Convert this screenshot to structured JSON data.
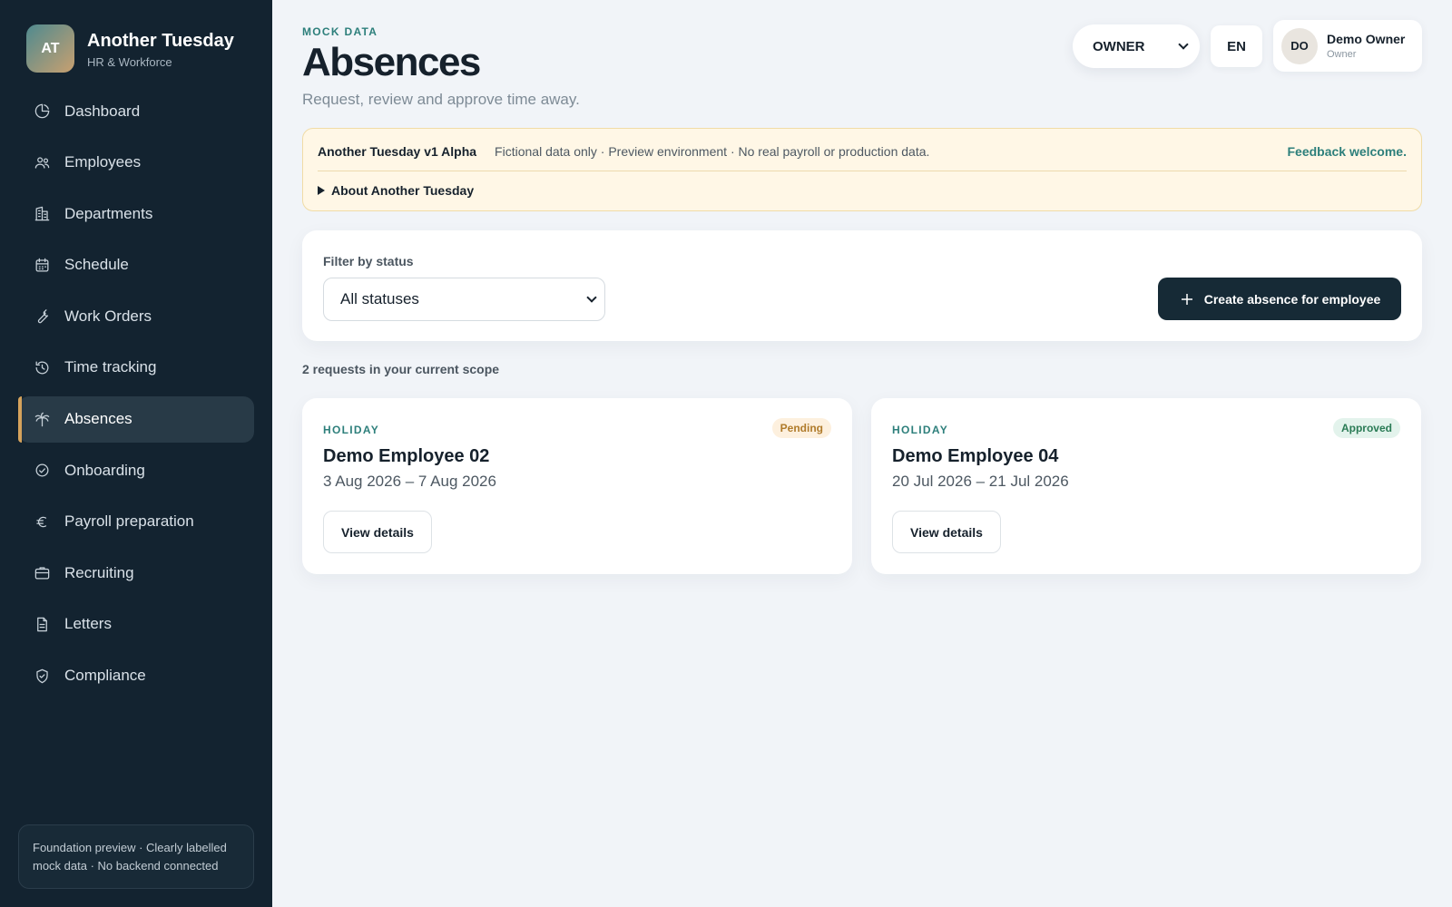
{
  "brand": {
    "initials": "AT",
    "name": "Another Tuesday",
    "subtitle": "HR & Workforce"
  },
  "sidebar": {
    "items": [
      {
        "label": "Dashboard",
        "icon": "dashboard-icon",
        "active": false
      },
      {
        "label": "Employees",
        "icon": "users-icon",
        "active": false
      },
      {
        "label": "Departments",
        "icon": "building-icon",
        "active": false
      },
      {
        "label": "Schedule",
        "icon": "calendar-icon",
        "active": false
      },
      {
        "label": "Work Orders",
        "icon": "wrench-icon",
        "active": false
      },
      {
        "label": "Time tracking",
        "icon": "history-icon",
        "active": false
      },
      {
        "label": "Absences",
        "icon": "palm-tree-icon",
        "active": true
      },
      {
        "label": "Onboarding",
        "icon": "check-circle-icon",
        "active": false
      },
      {
        "label": "Payroll preparation",
        "icon": "euro-icon",
        "active": false
      },
      {
        "label": "Recruiting",
        "icon": "briefcase-icon",
        "active": false
      },
      {
        "label": "Letters",
        "icon": "document-icon",
        "active": false
      },
      {
        "label": "Compliance",
        "icon": "shield-check-icon",
        "active": false
      }
    ],
    "footer_note": "Foundation preview · Clearly labelled mock data · No backend connected"
  },
  "header": {
    "eyebrow": "MOCK DATA",
    "title": "Absences",
    "subtitle": "Request, review and approve time away.",
    "role_select": "OWNER",
    "language": "EN",
    "user": {
      "initials": "DO",
      "name": "Demo Owner",
      "role": "Owner"
    }
  },
  "banner": {
    "title": "Another Tuesday v1 Alpha",
    "description": "Fictional data only · Preview environment · No real payroll or production data.",
    "feedback": "Feedback welcome.",
    "about": "About Another Tuesday"
  },
  "filter": {
    "label": "Filter by status",
    "selected": "All statuses",
    "create_button": "Create absence for employee"
  },
  "results": {
    "count_text": "2 requests in your current scope",
    "requests": [
      {
        "type": "HOLIDAY",
        "status": "Pending",
        "employee": "Demo Employee 02",
        "dates": "3 Aug 2026 – 7 Aug 2026",
        "action": "View details"
      },
      {
        "type": "HOLIDAY",
        "status": "Approved",
        "employee": "Demo Employee 04",
        "dates": "20 Jul 2026 – 21 Jul 2026",
        "action": "View details"
      }
    ]
  },
  "colors": {
    "sidebar_bg": "#132330",
    "accent_teal": "#2d7f7b",
    "active_marker": "#d6a35c",
    "primary_button": "#162a36",
    "banner_bg": "#fff7e6"
  }
}
